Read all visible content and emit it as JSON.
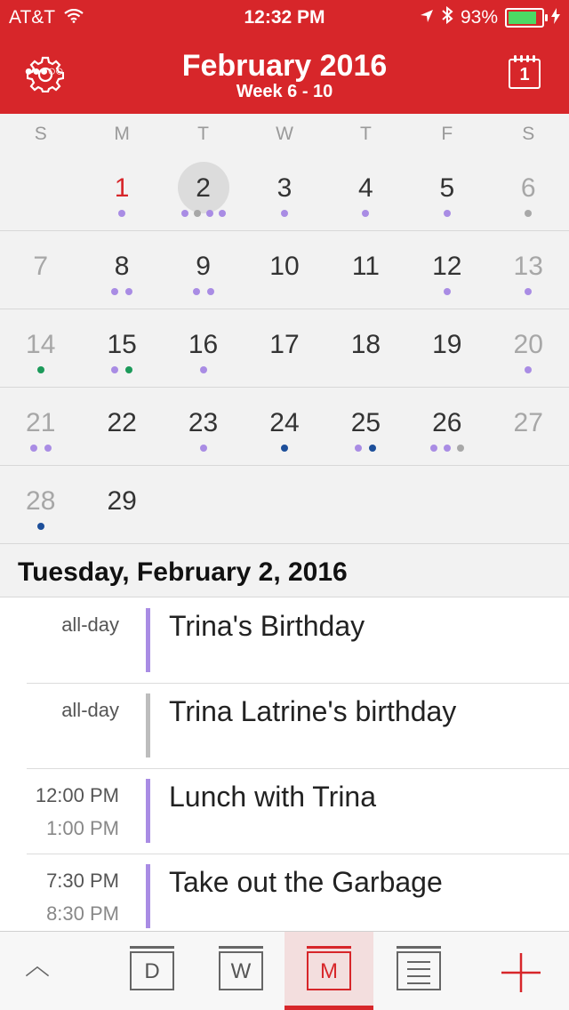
{
  "status": {
    "signal": "●●●○○",
    "carrier": "AT&T",
    "time": "12:32 PM",
    "battery": "93%"
  },
  "header": {
    "title": "February 2016",
    "subtitle": "Week 6 - 10",
    "today_num": "1"
  },
  "weekdays": [
    "S",
    "M",
    "T",
    "W",
    "T",
    "F",
    "S"
  ],
  "calendar": {
    "weeks": [
      [
        {
          "n": ""
        },
        {
          "n": "1"
        },
        {
          "n": "2"
        },
        {
          "n": "3"
        },
        {
          "n": "4"
        },
        {
          "n": "5"
        },
        {
          "n": "6"
        }
      ],
      [
        {
          "n": "7"
        },
        {
          "n": "8"
        },
        {
          "n": "9"
        },
        {
          "n": "10"
        },
        {
          "n": "11"
        },
        {
          "n": "12"
        },
        {
          "n": "13"
        }
      ],
      [
        {
          "n": "14"
        },
        {
          "n": "15"
        },
        {
          "n": "16"
        },
        {
          "n": "17"
        },
        {
          "n": "18"
        },
        {
          "n": "19"
        },
        {
          "n": "20"
        }
      ],
      [
        {
          "n": "21"
        },
        {
          "n": "22"
        },
        {
          "n": "23"
        },
        {
          "n": "24"
        },
        {
          "n": "25"
        },
        {
          "n": "26"
        },
        {
          "n": "27"
        }
      ],
      [
        {
          "n": "28"
        },
        {
          "n": "29"
        },
        {
          "n": ""
        },
        {
          "n": ""
        },
        {
          "n": ""
        },
        {
          "n": ""
        },
        {
          "n": ""
        }
      ]
    ]
  },
  "selected_date": "Tuesday, February 2, 2016",
  "events": [
    {
      "start": "all-day",
      "end": "",
      "title": "Trina's Birthday",
      "color": "#a98ce4"
    },
    {
      "start": "all-day",
      "end": "",
      "title": "Trina Latrine's birthday",
      "color": "#bdbdbd"
    },
    {
      "start": "12:00 PM",
      "end": "1:00 PM",
      "title": "Lunch with Trina",
      "color": "#a98ce4"
    },
    {
      "start": "7:30 PM",
      "end": "8:30 PM",
      "title": "Take out the Garbage",
      "color": "#a98ce4"
    }
  ],
  "tabbar": {
    "day": "D",
    "week": "W",
    "month": "M"
  },
  "colors": {
    "accent": "#d7262a",
    "purple": "#a98ce4",
    "gray": "#a8a8a8",
    "green": "#1c9a5a",
    "blue": "#1d4f9a"
  }
}
